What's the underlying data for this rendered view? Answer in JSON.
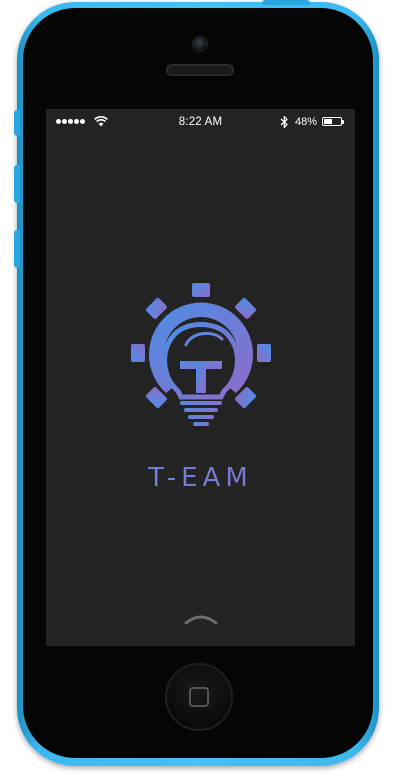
{
  "device": {
    "model": "iPhone 5c",
    "color": "#45c1f4"
  },
  "status_bar": {
    "time": "8:22 AM",
    "battery_percent": "48%",
    "battery_level": 0.48,
    "signal_dots": 5
  },
  "app": {
    "brand_name": "T-EAM",
    "logo_letter": "T",
    "logo_colors": {
      "start": "#4b8ee6",
      "end": "#8d6cc9"
    }
  }
}
